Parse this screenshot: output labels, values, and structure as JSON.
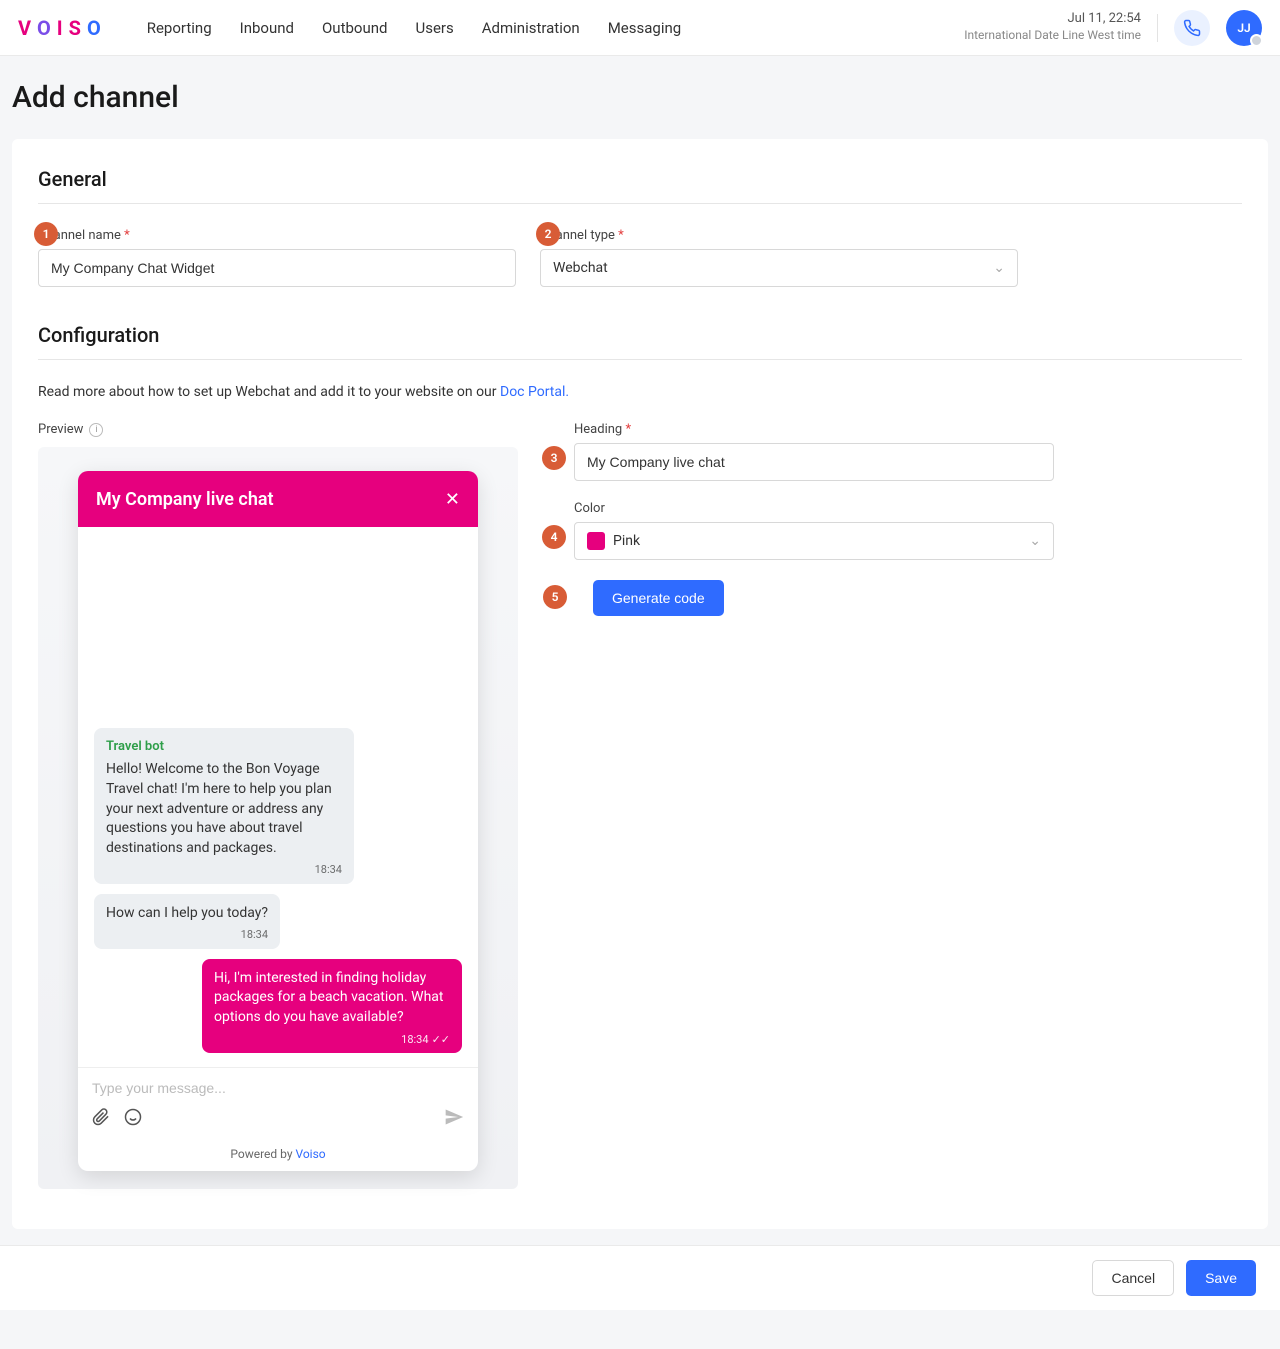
{
  "header": {
    "logo_letters": [
      "V",
      "O",
      "I",
      "S",
      "O"
    ],
    "nav": [
      "Reporting",
      "Inbound",
      "Outbound",
      "Users",
      "Administration",
      "Messaging"
    ],
    "datetime": "Jul 11, 22:54",
    "timezone": "International Date Line West time",
    "avatar_initials": "JJ"
  },
  "page": {
    "title": "Add channel"
  },
  "general": {
    "section_title": "General",
    "channel_name_label": "Channel name",
    "channel_name_value": "My Company Chat Widget",
    "channel_type_label": "Channel type",
    "channel_type_value": "Webchat"
  },
  "configuration": {
    "section_title": "Configuration",
    "help_text_prefix": "Read more about how to set up Webchat and add it to your website on our ",
    "help_link_text": "Doc Portal.",
    "preview_label": "Preview",
    "heading_label": "Heading",
    "heading_value": "My Company live chat",
    "color_label": "Color",
    "color_value": "Pink",
    "color_hex": "#e6007e",
    "generate_btn": "Generate code"
  },
  "preview_widget": {
    "header_title": "My Company live chat",
    "messages": [
      {
        "side": "bot",
        "botname": "Travel bot",
        "text": "Hello! Welcome to the Bon Voyage Travel chat! I'm here to help you plan your next adventure or address any questions you have about travel destinations and packages.",
        "time": "18:34"
      },
      {
        "side": "bot",
        "text": "How can I help you today?",
        "time": "18:34"
      },
      {
        "side": "user",
        "text": "Hi, I'm interested in finding holiday packages for a beach vacation. What options do you have available?",
        "time": "18:34",
        "read": true
      }
    ],
    "input_placeholder": "Type your message...",
    "powered_prefix": "Powered by ",
    "powered_link": "Voiso"
  },
  "callouts": {
    "c1": "1",
    "c2": "2",
    "c3": "3",
    "c4": "4",
    "c5": "5"
  },
  "footer": {
    "cancel": "Cancel",
    "save": "Save"
  }
}
